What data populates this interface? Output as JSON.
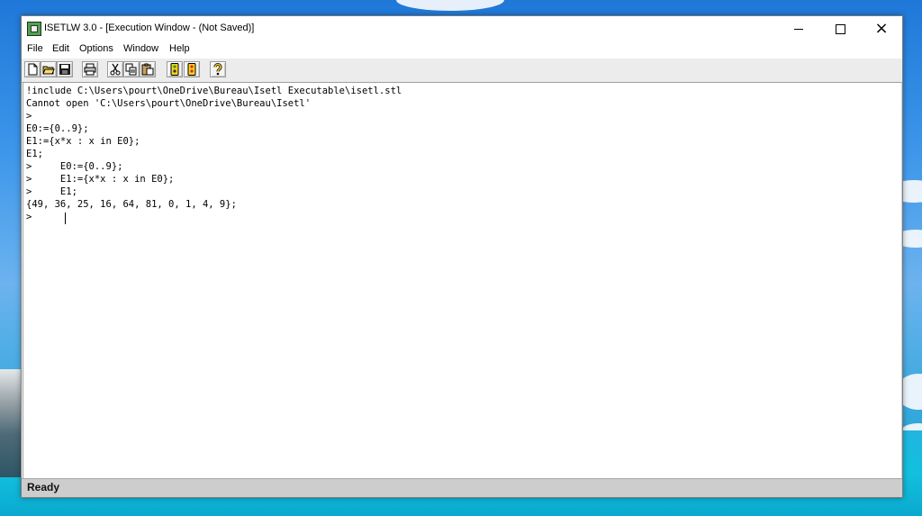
{
  "window": {
    "title": "ISETLW 3.0 - [Execution Window - (Not Saved)]",
    "controls": {
      "minimize": "minimize-icon",
      "maximize": "maximize-icon",
      "close": "×"
    }
  },
  "menubar": {
    "items": [
      "File",
      "Edit",
      "Options",
      "Window",
      "Help"
    ]
  },
  "toolbar": {
    "icons": [
      "new-file-icon",
      "open-folder-icon",
      "save-disk-icon",
      "print-icon",
      "cut-icon",
      "copy-icon",
      "paste-icon",
      "run-icon",
      "stop-icon",
      "help-question-icon"
    ]
  },
  "editor": {
    "lines": [
      "!include C:\\Users\\pourt\\OneDrive\\Bureau\\Isetl Executable\\isetl.stl",
      "Cannot open 'C:\\Users\\pourt\\OneDrive\\Bureau\\Isetl'",
      ">",
      "E0:={0..9};",
      "E1:={x*x : x in E0};",
      "E1;",
      ">     E0:={0..9};",
      ">     E1:={x*x : x in E0};",
      ">     E1;",
      "{49, 36, 25, 16, 64, 81, 0, 1, 4, 9};",
      ">"
    ]
  },
  "status": {
    "text": "Ready"
  },
  "colors": {
    "toolbar_bg": "#ececec",
    "statusbar_bg": "#cdcdcd",
    "run_icon": "#f2d31c",
    "stop_icon": "#e0252a",
    "help_icon": "#e8c21a"
  }
}
